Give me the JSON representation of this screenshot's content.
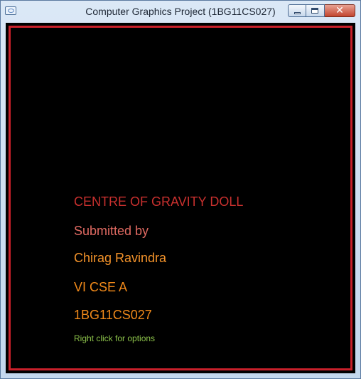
{
  "window": {
    "title": "Computer Graphics Project (1BG11CS027)",
    "controls": {
      "minimize_icon": "minimize-icon",
      "maximize_icon": "maximize-icon",
      "close_glyph": "✕"
    }
  },
  "content": {
    "title": "CENTRE OF GRAVITY DOLL",
    "submitted_by": "Submitted by",
    "name": "Chirag Ravindra",
    "class": "VI CSE A",
    "usn": "1BG11CS027",
    "hint": "Right click for options"
  },
  "colors": {
    "background": "#000000",
    "frame": "#c8202a",
    "title_text": "#c8302e",
    "submitted_text": "#e06a62",
    "name_text": "#f2922a",
    "hint_text": "#8cc24a"
  }
}
